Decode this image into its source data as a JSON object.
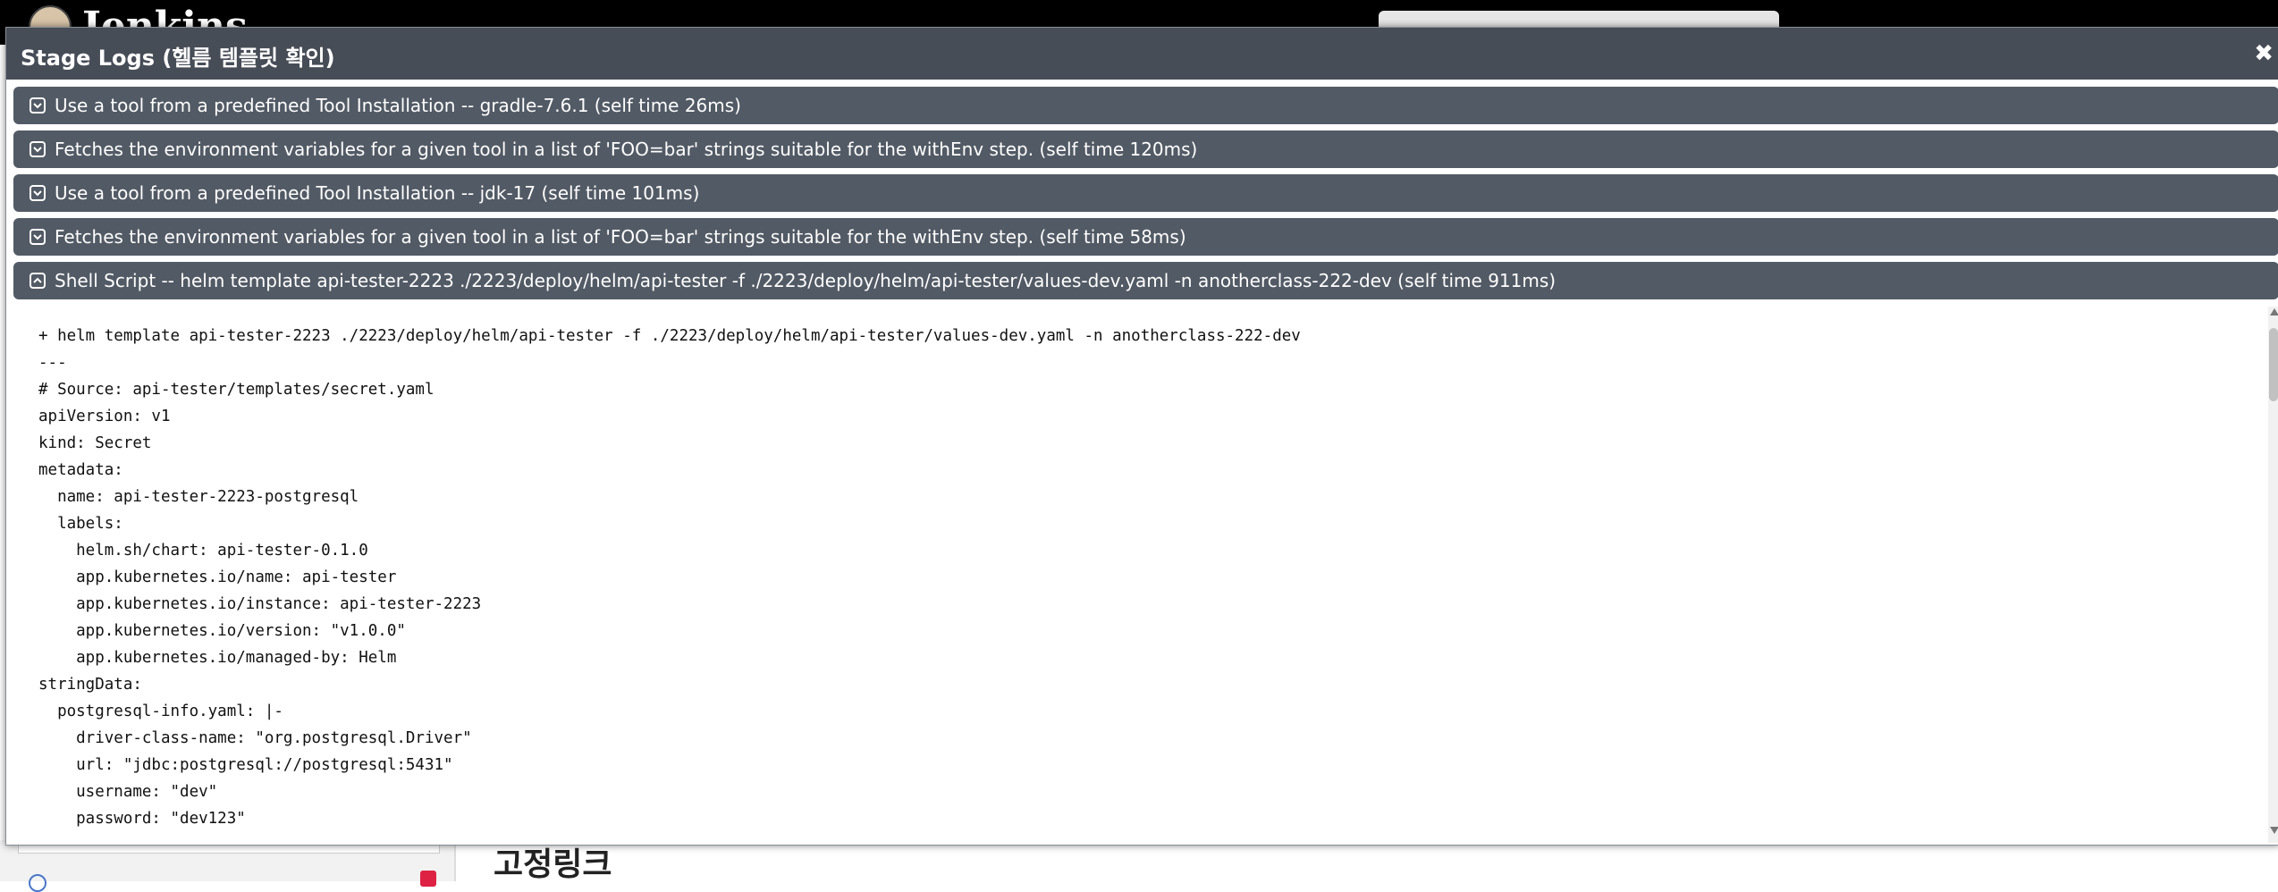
{
  "background": {
    "brand": "Jenkins",
    "heading": "고정링크"
  },
  "modal": {
    "title": "Stage Logs (헬름 템플릿 확인)",
    "close": "✖",
    "steps": [
      {
        "label": "Use a tool from a predefined Tool Installation -- gradle-7.6.1 (self time 26ms)",
        "state": "collapsed"
      },
      {
        "label": "Fetches the environment variables for a given tool in a list of 'FOO=bar' strings suitable for the withEnv step. (self time 120ms)",
        "state": "collapsed"
      },
      {
        "label": "Use a tool from a predefined Tool Installation -- jdk-17 (self time 101ms)",
        "state": "collapsed"
      },
      {
        "label": "Fetches the environment variables for a given tool in a list of 'FOO=bar' strings suitable for the withEnv step. (self time 58ms)",
        "state": "collapsed"
      },
      {
        "label": "Shell Script -- helm template api-tester-2223 ./2223/deploy/helm/api-tester -f ./2223/deploy/helm/api-tester/values-dev.yaml -n anotherclass-222-dev (self time 911ms)",
        "state": "expanded"
      }
    ],
    "log_lines": [
      "+ helm template api-tester-2223 ./2223/deploy/helm/api-tester -f ./2223/deploy/helm/api-tester/values-dev.yaml -n anotherclass-222-dev",
      "---",
      "# Source: api-tester/templates/secret.yaml",
      "apiVersion: v1",
      "kind: Secret",
      "metadata:",
      "  name: api-tester-2223-postgresql",
      "  labels:",
      "    helm.sh/chart: api-tester-0.1.0",
      "    app.kubernetes.io/name: api-tester",
      "    app.kubernetes.io/instance: api-tester-2223",
      "    app.kubernetes.io/version: \"v1.0.0\"",
      "    app.kubernetes.io/managed-by: Helm",
      "stringData:",
      "  postgresql-info.yaml: |-",
      "    driver-class-name: \"org.postgresql.Driver\"",
      "    url: \"jdbc:postgresql://postgresql:5431\"",
      "    username: \"dev\"",
      "    password: \"dev123\""
    ]
  }
}
